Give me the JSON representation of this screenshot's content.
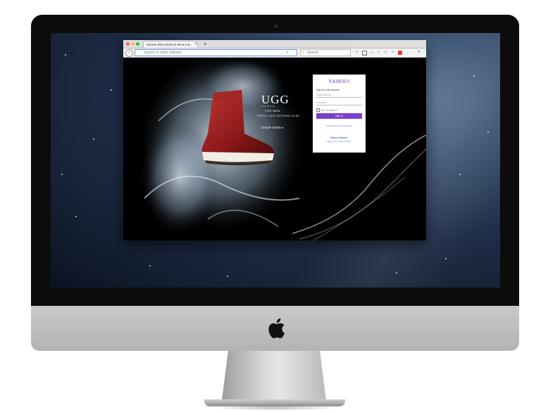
{
  "browser": {
    "tab_title": "Screen Shot 2016-11-25 at 2.5...",
    "tab_close": "×",
    "new_tab": "+",
    "url_placeholder": "Search or enter address",
    "search_placeholder": "Search"
  },
  "page": {
    "brand": "UGG",
    "brand_sub": "AUSTRALIA",
    "for_men": "FOR MEN",
    "tagline": "FEELS LIKE NOTHING ELSE",
    "shop_now": "SHOP NOW ▸"
  },
  "login": {
    "logo": "YAHOO!",
    "signin_prompt": "Sign in to your account",
    "email_placeholder": "Email address",
    "password_placeholder": "Password",
    "stay_signed_in": "Keep me signed in",
    "signin_button": "Sign in",
    "cant_access": "Can't access your account?",
    "new_to": "New to Yahoo?",
    "signup": "Sign up for a new account"
  },
  "colors": {
    "yahoo_purple": "#7b3fd0",
    "link_blue": "#3a71c9",
    "boot_red": "#8f1a1a"
  }
}
